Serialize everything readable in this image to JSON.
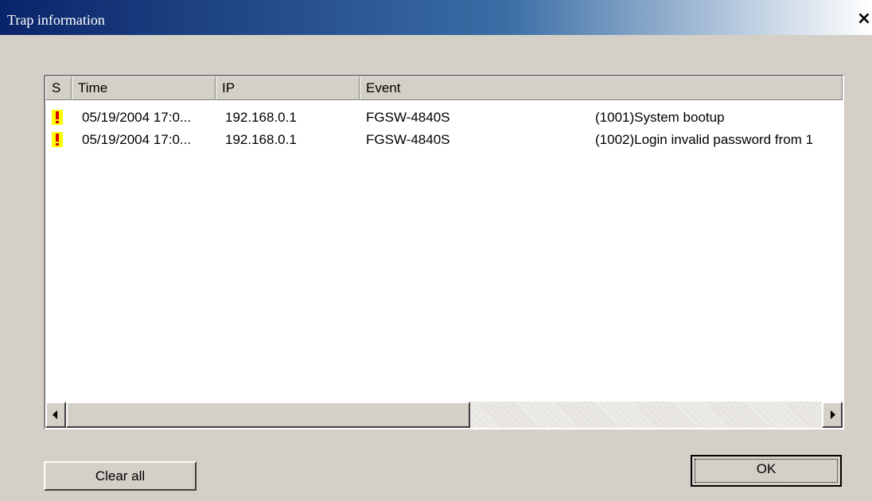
{
  "window": {
    "title": "Trap information",
    "close_label": "×"
  },
  "table": {
    "columns": [
      "S",
      "Time",
      "IP",
      "Event",
      ""
    ],
    "rows": [
      {
        "severity_icon": "warning-exclamation-icon",
        "time": "05/19/2004 17:0...",
        "ip": "192.168.0.1",
        "device": "FGSW-4840S",
        "message": "(1001)System bootup"
      },
      {
        "severity_icon": "warning-exclamation-icon",
        "time": "05/19/2004 17:0...",
        "ip": "192.168.0.1",
        "device": "FGSW-4840S",
        "message": "(1002)Login invalid password from 1"
      }
    ]
  },
  "buttons": {
    "clear_all": "Clear all",
    "ok": "OK"
  },
  "colors": {
    "titlebar_start": "#0a246a",
    "titlebar_end": "#ffffff",
    "window_face": "#d4d0c8",
    "warning_fill": "#ffff00",
    "warning_mark": "#e00000"
  }
}
